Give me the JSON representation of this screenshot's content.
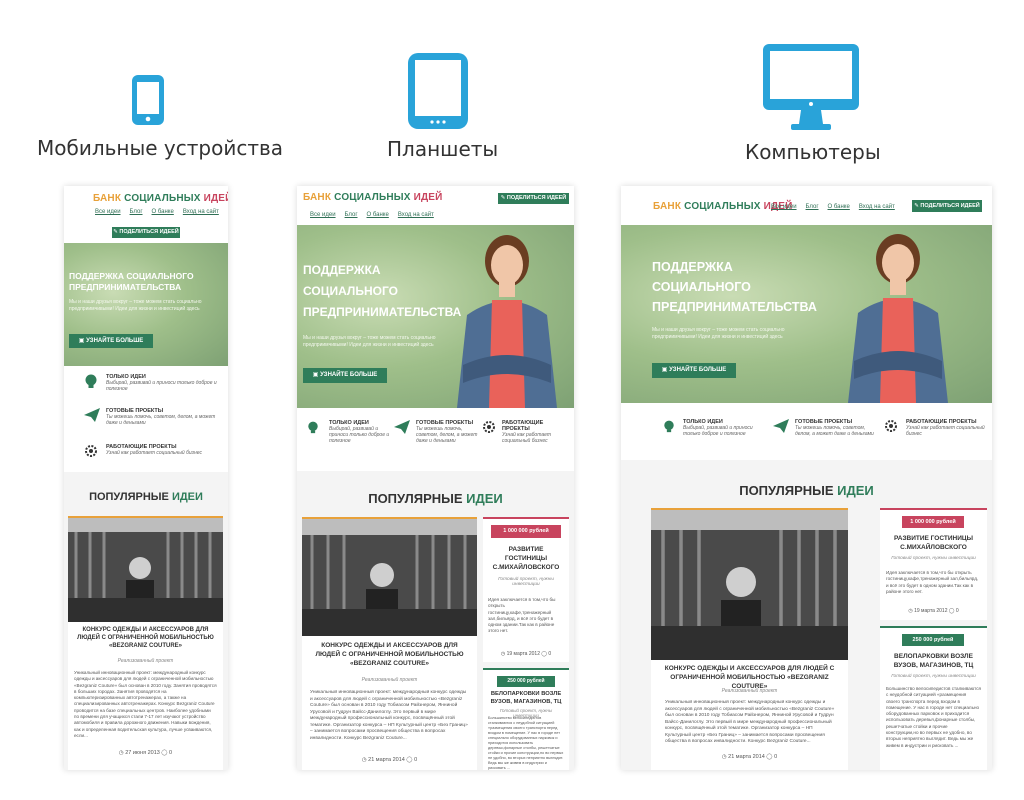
{
  "labels": {
    "mobile": "Мобильные устройства",
    "tablet": "Планшеты",
    "desktop": "Компьютеры"
  },
  "icons": {
    "mobile": "phone-icon",
    "tablet": "tablet-icon",
    "desktop": "monitor-icon"
  },
  "colors": {
    "icon_blue": "#29a3d9",
    "brand_green": "#2f7d5a",
    "brand_pink": "#c8445e",
    "brand_orange": "#e8a13a"
  },
  "site": {
    "logo": {
      "part1": "БАНК ",
      "part2": "СОЦИАЛЬНЫХ ",
      "part3": "ИДЕЙ"
    },
    "nav": [
      "Все идеи",
      "Блог",
      "О банке",
      "Вход на сайт"
    ],
    "share_button": "ПОДЕЛИТЬСЯ ИДЕЕЙ",
    "hero": {
      "title_mobile": "ПОДДЕРЖКА СОЦИАЛЬНОГО ПРЕДПРИНИМАТЕЛЬСТВА",
      "title_line1": "ПОДДЕРЖКА",
      "title_line2": "СОЦИАЛЬНОГО",
      "title_line3": "ПРЕДПРИНИМАТЕЛЬСТВА",
      "text": "Мы и наши друзья вокруг – тоже можем стать социально предприимчивыми! Идеи для жизни и инвестиций здесь",
      "button": "УЗНАЙТЕ БОЛЬШЕ"
    },
    "features": [
      {
        "title": "ТОЛЬКО ИДЕИ",
        "desc": "Выбирай, развивай и приноси только доброе и полезное",
        "icon": "lightbulb-icon"
      },
      {
        "title": "ГОТОВЫЕ ПРОЕКТЫ",
        "desc": "Ты можешь помочь, советом, делом, а может даже и деньгами",
        "icon": "paper-plane-icon"
      },
      {
        "title": "РАБОТАЮЩИЕ ПРОЕКТЫ",
        "desc": "Узнай как работает социальный бизнес",
        "icon": "gear-icon"
      }
    ],
    "popular": {
      "part1": "ПОПУЛЯРНЫЕ ",
      "part2": "ИДЕИ"
    },
    "main_card": {
      "title": "КОНКУРС ОДЕЖДЫ И АКСЕССУАРОВ ДЛЯ ЛЮДЕЙ С ОГРАНИЧЕННОЙ МОБИЛЬНОСТЬЮ «BEZGRANIZ COUTURE»",
      "subtitle": "Реализованный проект",
      "body": "Уникальный инновационный проект: международный конкурс одежды и аксессуаров для людей с ограниченной мобильностью «Bezgraniz Couture» был основан в 2010 году Тобиасом Райзнером, Янниной Урусовой и Гудрун Вайсс-Данилоглу. Это первый в мире международный профессиональный конкурс, посвящённый этой тематике. Организатор конкурса – НП Культурный центр «Без Границ» – занимается вопросами просвещения общества в вопросах инвалидности. Конкурс Bezgraniz Couture...",
      "body_mobile": "Уникальный инновационный проект: международный конкурс одежды и аксессуаров для людей с ограниченной мобильностью «Bezgraniz Couture» был основан в 2010 году. Занятия проводятся в больших городах. Занятия проводятся на компьютеризированных автотренажерах, а также на специализированных автотренажерах. Конкурс Bezgraniz Couture проводится на базе специальных центров. Наиболее удобными по времени для учащихся стали 7-17 лет изучают устройство автомобиля и правила дорожного движения. Навыки вождения, как и определенная водительская культура, лучше усваиваются, если...",
      "date_mobile": "27 июня 2013",
      "date": "21 марта 2014",
      "comments": "0"
    },
    "side_card1": {
      "amount": "1 000 000 рублей",
      "title": "РАЗВИТИЕ ГОСТИНИЦЫ С.МИХАЙЛОВСКОГО",
      "subtitle": "Готовый проект, нужны инвестиции",
      "body": "Идея заключается в том,что бы открыть гостиницу,кафе,тренажерный зал,бильярд, и всё это будет в одном здании.Так как в районе этого нет.",
      "date": "19 марта 2012",
      "comments": "0"
    },
    "side_card2": {
      "amount": "250 000 рублей",
      "title": "ВЕЛОПАРКОВКИ ВОЗЛЕ ВУЗОВ, МАГАЗИНОВ, ТЦ",
      "subtitle": "Готовый проект, нужны инвестиции",
      "body": "Большинство велосипедистов сталкиваются с неудобной ситуацией «размещения своего транспорта перед входом в помещение. У нас в городе нет специально оборудованных парковок и приходится использовать деревья,фонарные столбы, решетчатые стойки и прочие конструкции,но во первых не удобно, во вторых неприятно выглядит. Ведь мы же живем в индустрии и рисковать ..."
    }
  }
}
